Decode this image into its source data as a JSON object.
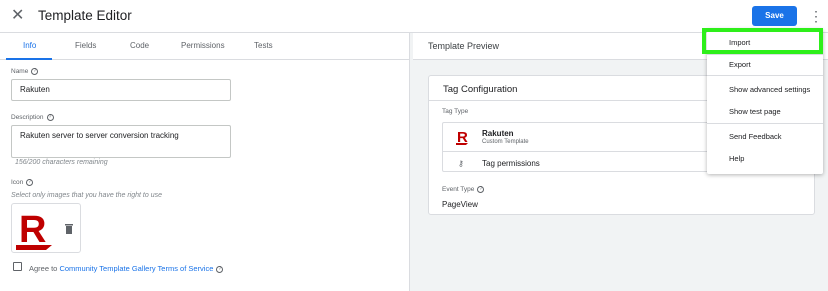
{
  "header": {
    "title": "Template Editor",
    "save_label": "Save",
    "close_icon": "close-icon",
    "more_icon": "more-vert-icon",
    "save_color": "#1a73e8"
  },
  "tabs": [
    {
      "label": "Info",
      "active": true
    },
    {
      "label": "Fields"
    },
    {
      "label": "Code"
    },
    {
      "label": "Permissions"
    },
    {
      "label": "Tests"
    }
  ],
  "info": {
    "name_label": "Name",
    "name_value": "Rakuten",
    "description_label": "Description",
    "description_value": "Rakuten server to server conversion tracking",
    "char_remaining": "156/200 characters remaining",
    "icon_label": "Icon",
    "icon_hint": "Select only images that you have the right to use",
    "agree_prefix": "Agree to ",
    "agree_link": "Community Template Gallery Terms of Service",
    "accent_color": "#bf0000"
  },
  "preview": {
    "title": "Template Preview",
    "card_title": "Tag Configuration",
    "tag_type_label": "Tag Type",
    "tag_name": "Rakuten",
    "tag_sub": "Custom Template",
    "tag_permissions": "Tag permissions",
    "event_type_label": "Event Type",
    "event_type_value": "PageView"
  },
  "menu": {
    "items": [
      {
        "label": "Import"
      },
      {
        "label": "Export"
      },
      {
        "label": "Show advanced settings"
      },
      {
        "label": "Show test page"
      },
      {
        "label": "Send Feedback"
      },
      {
        "label": "Help"
      }
    ],
    "highlight_color": "#2eef1a"
  }
}
